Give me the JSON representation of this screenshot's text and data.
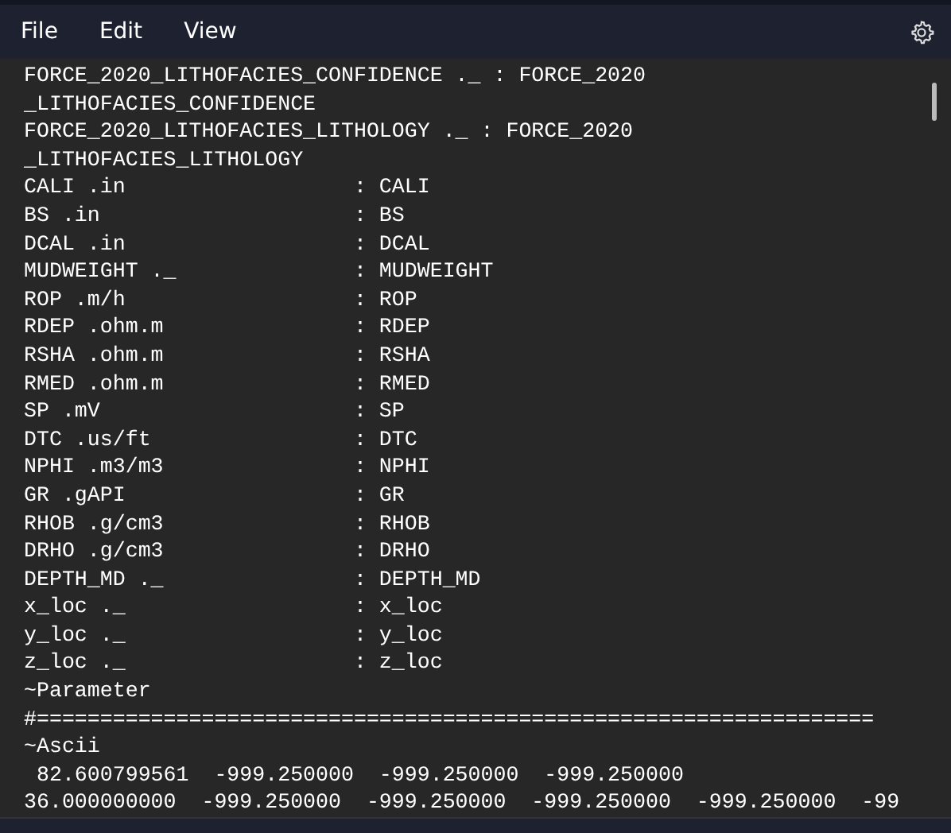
{
  "menu": [
    "File",
    "Edit",
    "View"
  ],
  "editor": {
    "lines": [
      "FORCE_2020_LITHOFACIES_CONFIDENCE ._ : FORCE_2020",
      "_LITHOFACIES_CONFIDENCE",
      "FORCE_2020_LITHOFACIES_LITHOLOGY ._ : FORCE_2020",
      "_LITHOFACIES_LITHOLOGY",
      "CALI .in                  : CALI",
      "BS .in                    : BS",
      "DCAL .in                  : DCAL",
      "MUDWEIGHT ._              : MUDWEIGHT",
      "ROP .m/h                  : ROP",
      "RDEP .ohm.m               : RDEP",
      "RSHA .ohm.m               : RSHA",
      "RMED .ohm.m               : RMED",
      "SP .mV                    : SP",
      "DTC .us/ft                : DTC",
      "NPHI .m3/m3               : NPHI",
      "GR .gAPI                  : GR",
      "RHOB .g/cm3               : RHOB",
      "DRHO .g/cm3               : DRHO",
      "DEPTH_MD ._               : DEPTH_MD",
      "x_loc ._                  : x_loc",
      "y_loc ._                  : y_loc",
      "z_loc ._                  : z_loc",
      "~Parameter",
      "#==================================================================",
      "~Ascii",
      " 82.600799561  -999.250000  -999.250000  -999.250000",
      "36.000000000  -999.250000  -999.250000  -999.250000  -999.250000  -99"
    ]
  }
}
